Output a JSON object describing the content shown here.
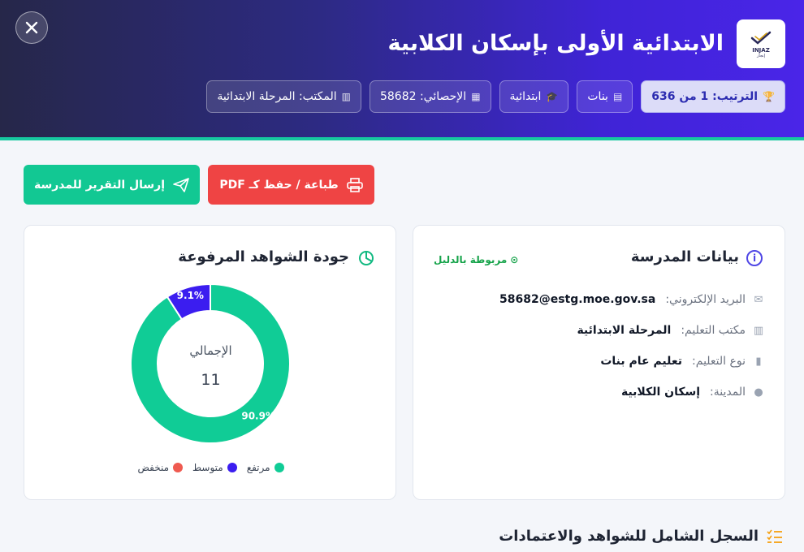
{
  "header": {
    "title": "الابتدائية الأولى بإسكان الكلابية",
    "logo_text": "INJAZ",
    "logo_sub": "إنجاز",
    "chips": [
      {
        "label": "الترتيب: 1 من 636",
        "icon": "trophy-icon"
      },
      {
        "label": "بنات",
        "icon": "id-icon"
      },
      {
        "label": "ابتدائية",
        "icon": "graduation-cap-icon"
      },
      {
        "label": "الإحصائي: 58682",
        "icon": "hash-icon"
      },
      {
        "label": "المكتب: المرحلة الابتدائية",
        "icon": "building-icon"
      }
    ]
  },
  "actions": {
    "print_label": "طباعة / حفظ كـ PDF",
    "send_label": "إرسال التقرير للمدرسة"
  },
  "school_info": {
    "title": "بيانات المدرسة",
    "linked_label": "مربوطة بالدليل",
    "rows": [
      {
        "label": "البريد الإلكتروني:",
        "value": "58682@estg.moe.gov.sa",
        "icon": "envelope-icon"
      },
      {
        "label": "مكتب التعليم:",
        "value": "المرحلة الابتدائية",
        "icon": "building-icon"
      },
      {
        "label": "نوع التعليم:",
        "value": "تعليم عام بنات",
        "icon": "books-icon"
      },
      {
        "label": "المدينة:",
        "value": "إسكان الكلابية",
        "icon": "location-pin-icon"
      }
    ]
  },
  "quality": {
    "title": "جودة الشواهد المرفوعة",
    "center_label": "الإجمالي",
    "center_value": "11",
    "legend": [
      {
        "label": "مرتفع",
        "color": "#10cc96"
      },
      {
        "label": "متوسط",
        "color": "#3b1df0"
      },
      {
        "label": "منخفض",
        "color": "#ef5a50"
      }
    ]
  },
  "chart_data": {
    "type": "pie",
    "categories": [
      "مرتفع",
      "متوسط",
      "منخفض"
    ],
    "values": [
      90.9,
      9.1,
      0
    ],
    "data_labels": [
      "90.9%",
      "9.1%",
      ""
    ],
    "colors": [
      "#10cc96",
      "#3b1df0",
      "#ef5a50"
    ],
    "total": 11
  },
  "record_section": {
    "title": "السجل الشامل للشواهد والاعتمادات"
  }
}
